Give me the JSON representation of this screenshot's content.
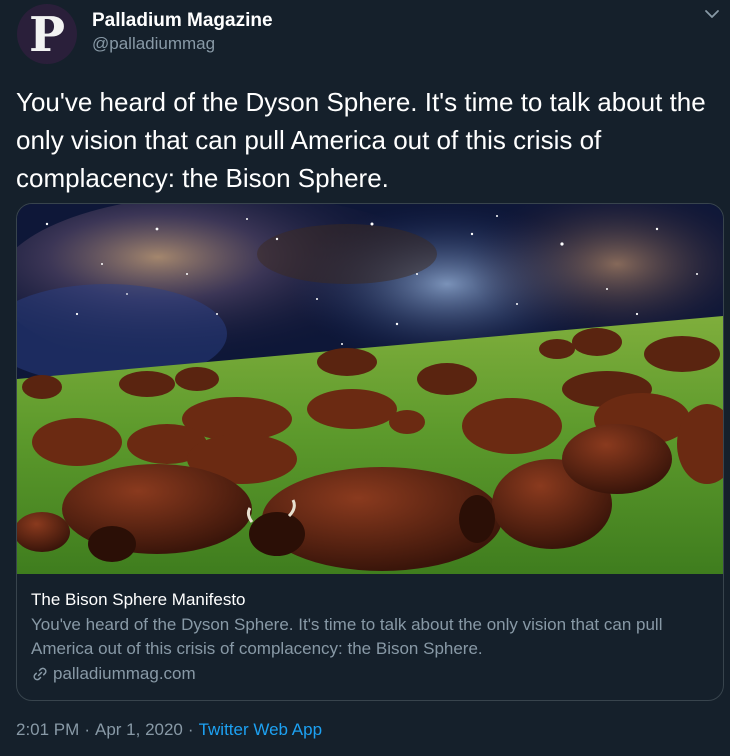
{
  "author": {
    "avatar_letter": "P",
    "display_name": "Palladium Magazine",
    "handle": "@palladiummag"
  },
  "tweet": {
    "text": "You've heard of the Dyson Sphere. It's time to talk about the only vision that can pull America out of this crisis of complacency: the Bison Sphere."
  },
  "card": {
    "title": "The Bison Sphere Manifesto",
    "description": "You've heard of the Dyson Sphere. It's time to talk about the only vision that can pull America out of this crisis of complacency: the Bison Sphere.",
    "domain": "palladiummag.com",
    "image_subject": "bison herd on grassland under starry nebula sky"
  },
  "meta": {
    "time": "2:01 PM",
    "date": "Apr 1, 2020",
    "separator": "·",
    "source": "Twitter Web App"
  },
  "icons": {
    "menu": "chevron-down-icon",
    "link": "link-icon"
  },
  "colors": {
    "background": "#15202b",
    "secondary_text": "#8899a6",
    "accent": "#1da1f2",
    "border": "#38444d"
  }
}
